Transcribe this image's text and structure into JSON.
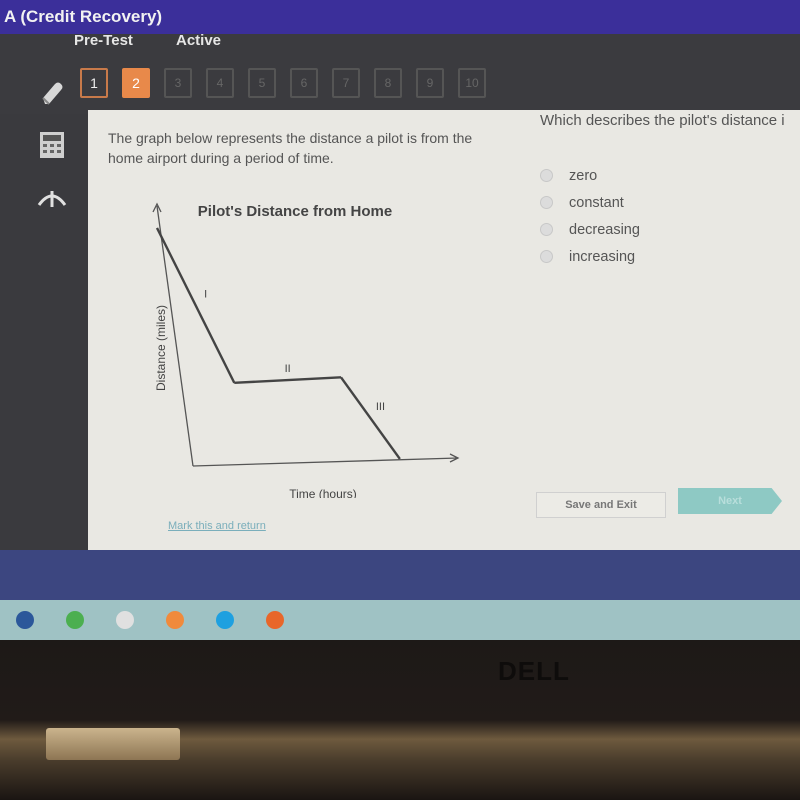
{
  "window": {
    "title": "A (Credit Recovery)"
  },
  "header": {
    "tabs": [
      {
        "label": "Pre-Test"
      },
      {
        "label": "Active"
      }
    ],
    "question_nav": [
      {
        "label": "1",
        "state": "answered"
      },
      {
        "label": "2",
        "state": "current"
      },
      {
        "label": "3",
        "state": "locked"
      },
      {
        "label": "4",
        "state": "locked"
      },
      {
        "label": "5",
        "state": "locked"
      },
      {
        "label": "6",
        "state": "locked"
      },
      {
        "label": "7",
        "state": "locked"
      },
      {
        "label": "8",
        "state": "locked"
      },
      {
        "label": "9",
        "state": "locked"
      },
      {
        "label": "10",
        "state": "locked"
      }
    ],
    "accent_color": "#e8894a",
    "title_bar_color": "#3b2f9a"
  },
  "toolbar": {
    "tools": [
      {
        "icon": "pencil-icon"
      },
      {
        "icon": "calculator-icon"
      },
      {
        "icon": "reference-arrow-icon"
      }
    ]
  },
  "content": {
    "prompt": "The graph below represents the distance a pilot is from the home airport during a period of time.",
    "question": "Which describes the pilot's distance i",
    "options": [
      {
        "label": "zero"
      },
      {
        "label": "constant"
      },
      {
        "label": "decreasing"
      },
      {
        "label": "increasing"
      }
    ],
    "mark_link": "Mark this and return",
    "save_label": "Save and Exit",
    "next_label": "Next",
    "next_color": "#8ec9c4"
  },
  "chart_data": {
    "type": "line",
    "title": "Pilot's Distance from Home",
    "xlabel": "Time (hours)",
    "ylabel": "Distance (miles)",
    "grid": false,
    "x_ticks": [],
    "y_ticks": [],
    "series": [
      {
        "name": "distance",
        "x": [
          0,
          2.1,
          5,
          6.6
        ],
        "y": [
          10,
          3.4,
          3.5,
          0
        ]
      }
    ],
    "segment_labels": [
      {
        "label": "I",
        "segment": 1
      },
      {
        "label": "II",
        "segment": 2
      },
      {
        "label": "III",
        "segment": 3
      }
    ],
    "xlim": [
      0,
      7.5
    ],
    "ylim": [
      0,
      10.5
    ]
  },
  "taskbar": {
    "items": [
      {
        "icon": "word-icon"
      },
      {
        "icon": "chrome-icon"
      },
      {
        "icon": "app-icon"
      },
      {
        "icon": "media-player-icon"
      },
      {
        "icon": "internet-explorer-icon"
      },
      {
        "icon": "firefox-icon"
      }
    ]
  },
  "hardware": {
    "brand": "DELL"
  }
}
